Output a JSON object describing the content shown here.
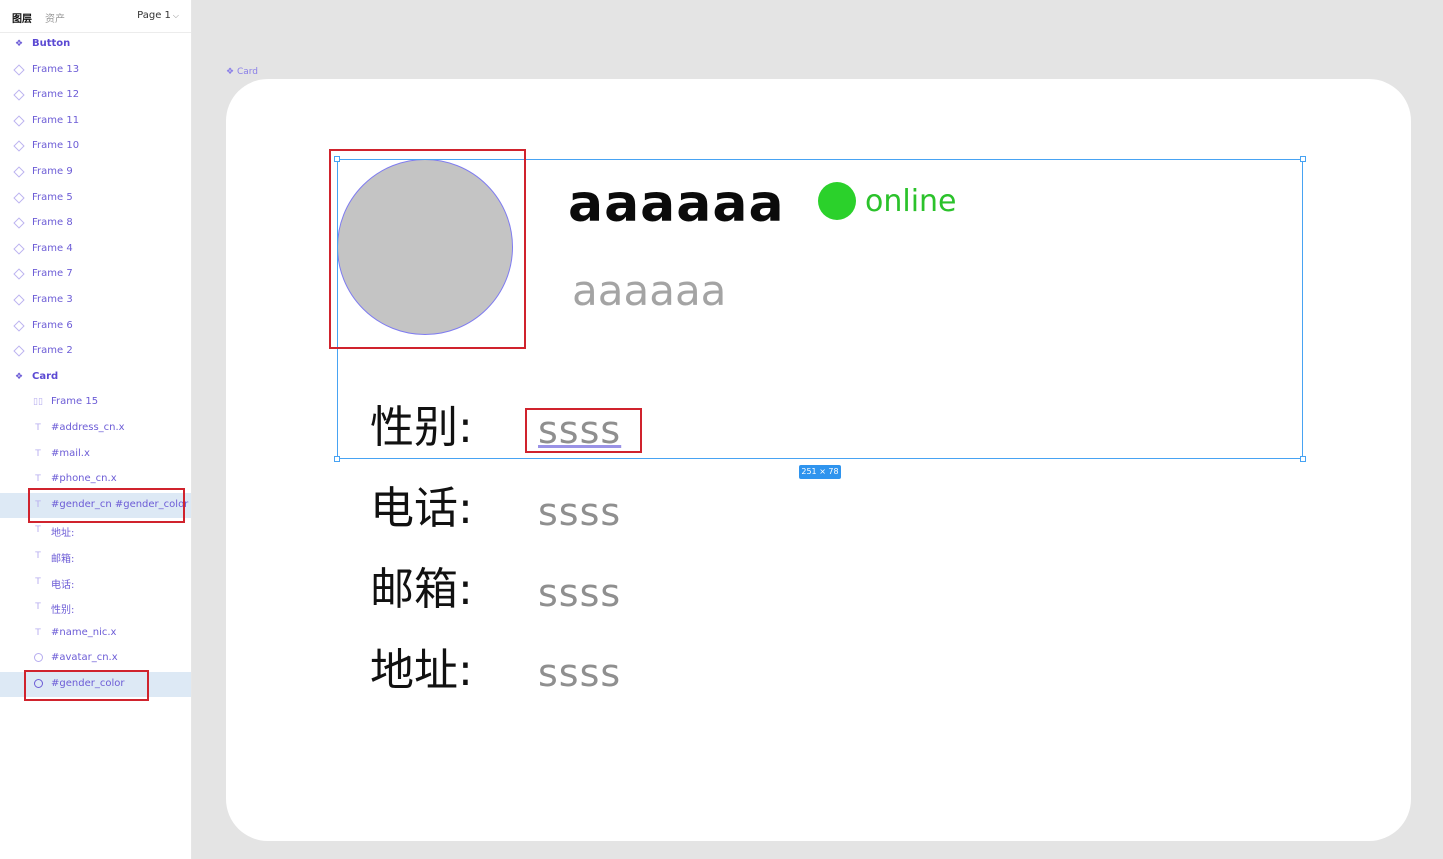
{
  "header": {
    "tab_layers": "图层",
    "tab_assets": "资产",
    "page": "Page 1"
  },
  "layers": [
    {
      "label": "Button",
      "type": "component",
      "level": 0
    },
    {
      "label": "Frame 13",
      "type": "frame",
      "level": 0
    },
    {
      "label": "Frame 12",
      "type": "frame",
      "level": 0
    },
    {
      "label": "Frame 11",
      "type": "frame",
      "level": 0
    },
    {
      "label": "Frame 10",
      "type": "frame",
      "level": 0
    },
    {
      "label": "Frame 9",
      "type": "frame",
      "level": 0
    },
    {
      "label": "Frame 5",
      "type": "frame",
      "level": 0
    },
    {
      "label": "Frame 8",
      "type": "frame",
      "level": 0
    },
    {
      "label": "Frame 4",
      "type": "frame",
      "level": 0
    },
    {
      "label": "Frame 7",
      "type": "frame",
      "level": 0
    },
    {
      "label": "Frame 3",
      "type": "frame",
      "level": 0
    },
    {
      "label": "Frame 6",
      "type": "frame",
      "level": 0
    },
    {
      "label": "Frame 2",
      "type": "frame",
      "level": 0
    },
    {
      "label": "Card",
      "type": "component",
      "level": 0
    },
    {
      "label": "Frame 15",
      "type": "autolayout",
      "level": 1
    },
    {
      "label": "#address_cn.x",
      "type": "text",
      "level": 1
    },
    {
      "label": "#mail.x",
      "type": "text",
      "level": 1
    },
    {
      "label": "#phone_cn.x",
      "type": "text",
      "level": 1
    },
    {
      "label": "#gender_cn #gender_color",
      "type": "text",
      "level": 1,
      "selected": true
    },
    {
      "label": "地址:",
      "type": "text",
      "level": 1
    },
    {
      "label": "邮箱:",
      "type": "text",
      "level": 1
    },
    {
      "label": "电话:",
      "type": "text",
      "level": 1
    },
    {
      "label": "性别:",
      "type": "text",
      "level": 1
    },
    {
      "label": "#name_nic.x",
      "type": "text",
      "level": 1
    },
    {
      "label": "#avatar_cn.x",
      "type": "ellipse",
      "level": 1
    },
    {
      "label": "#gender_color",
      "type": "ellipse",
      "level": 1,
      "selected": true
    }
  ],
  "canvas": {
    "frame_label": "Card",
    "name": "aaaaaa",
    "status": "online",
    "nickname": "aaaaaa",
    "fields": [
      {
        "label": "性别:",
        "value": "ssss"
      },
      {
        "label": "电话:",
        "value": "ssss"
      },
      {
        "label": "邮箱:",
        "value": "ssss"
      },
      {
        "label": "地址:",
        "value": "ssss"
      }
    ],
    "selection_size": "251 × 78"
  },
  "colors": {
    "accent": "#6c5cd6",
    "status_green": "#2bd12b",
    "selection_blue": "#47a3f3",
    "highlight_red": "#d0232d"
  }
}
